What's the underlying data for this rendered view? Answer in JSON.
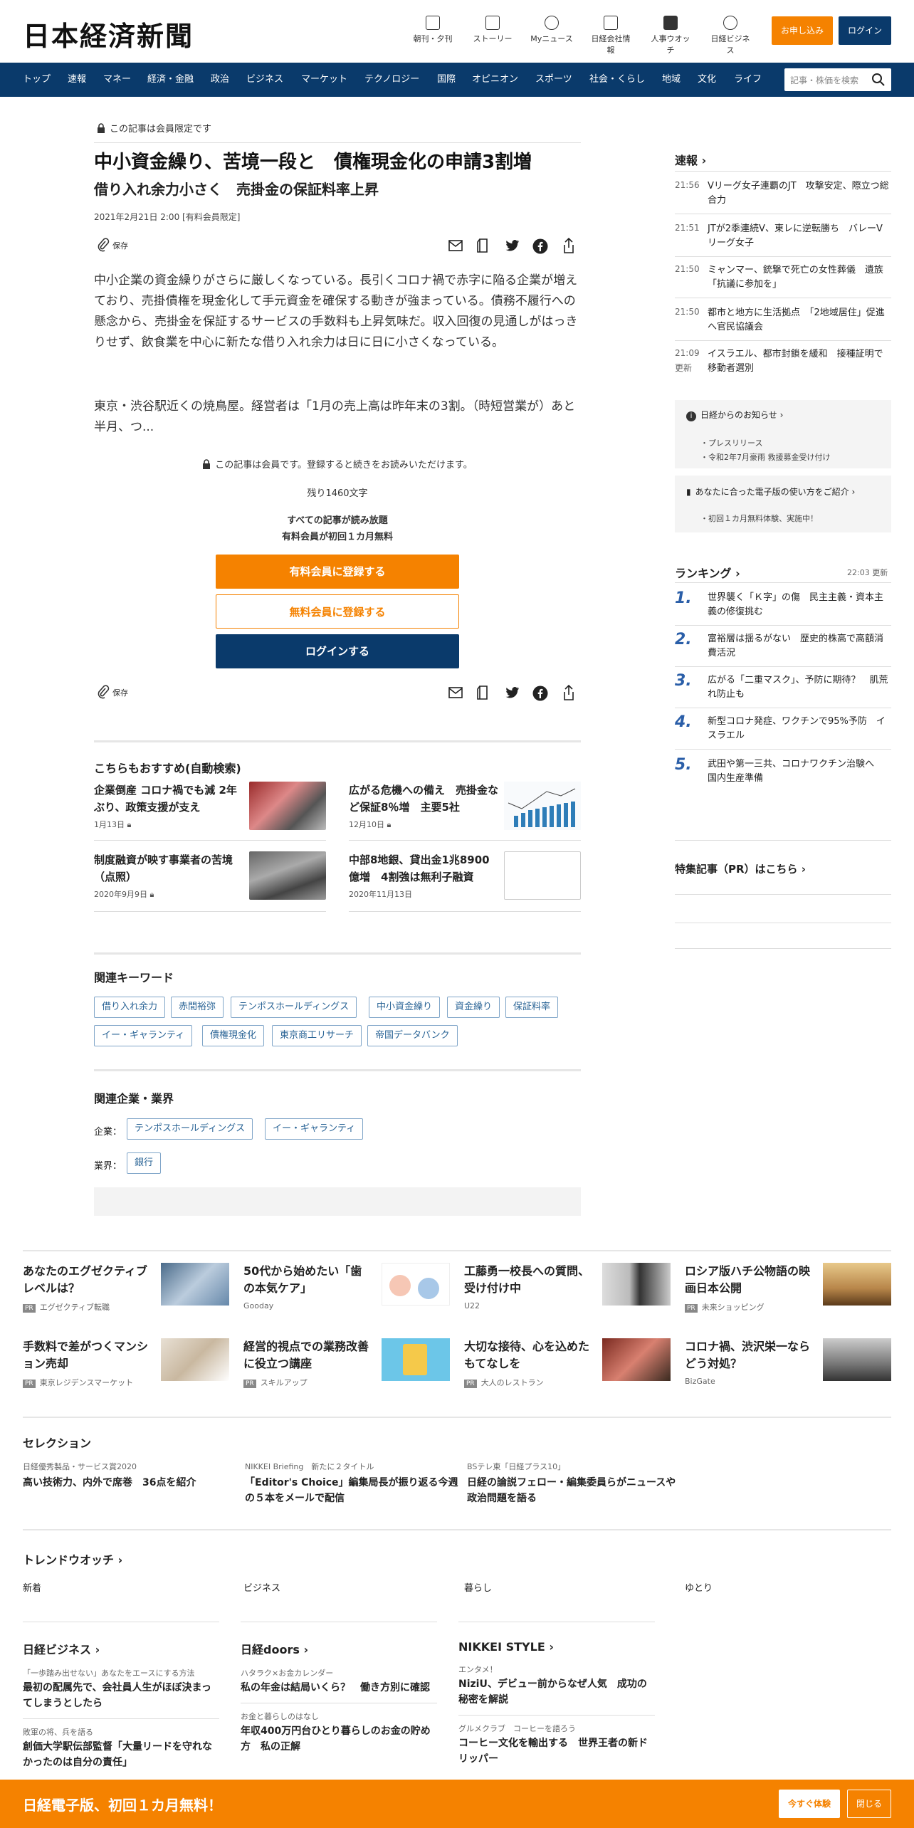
{
  "header": {
    "logo": "日本経済新聞",
    "icons": [
      {
        "label": "朝刊・夕刊"
      },
      {
        "label": "ストーリー"
      },
      {
        "label": "Myニュース"
      },
      {
        "label": "日経会社情報"
      },
      {
        "label": "人事ウオッチ"
      },
      {
        "label": "日経ビジネス"
      }
    ],
    "subscribe": "お申し込み",
    "login": "ログイン"
  },
  "nav": {
    "items": [
      "トップ",
      "速報",
      "マネー",
      "経済・金融",
      "政治",
      "ビジネス",
      "マーケット",
      "テクノロジー",
      "国際",
      "オピニオン",
      "スポーツ",
      "社会・くらし",
      "地域",
      "文化",
      "ライフ"
    ],
    "search_placeholder": "記事・株価を検索"
  },
  "article": {
    "members_only": "この記事は会員限定です",
    "title": "中小資金繰り、苦境一段と　債権現金化の申請3割増",
    "subtitle": "借り入れ余力小さく　売掛金の保証料率上昇",
    "date": "2021年2月21日 2:00 [有料会員限定]",
    "save": "保存",
    "p1": "中小企業の資金繰りがさらに厳しくなっている。長引くコロナ禍で赤字に陥る企業が増えており、売掛債権を現金化して手元資金を確保する動きが強まっている。債務不履行への懸念から、売掛金を保証するサービスの手数料も上昇気味だ。収入回復の見通しがはっきりせず、飲食業を中心に新たな借り入れ余力は日に日に小さくなっている。",
    "p2": "東京・渋谷駅近くの焼鳥屋。経営者は「1月の売上高は昨年末の3割。（時短営業が）あと半月、つ...",
    "members_note": "この記事は会員です。登録すると続きをお読みいただけます。",
    "remaining": "残り1460文字",
    "offer1": "すべての記事が読み放題",
    "offer2": "有料会員が初回１カ月無料",
    "btn_paid": "有料会員に登録する",
    "btn_free": "無料会員に登録する",
    "btn_login": "ログインする"
  },
  "recommend": {
    "title": "こちらもおすすめ(自動検索)",
    "items": [
      {
        "title": "企業倒産 コロナ禍でも減 2年ぶり、政策支援が支え",
        "date": "1月13日"
      },
      {
        "title": "広がる危機への備え　売掛金など保証8％増　主要5社",
        "date": "12月10日"
      },
      {
        "title": "制度融資が映す事業者の苦境（点照）",
        "date": "2020年9月9日"
      },
      {
        "title": "中部8地銀、貸出金1兆8900億増　4割強は無利子融資",
        "date": "2020年11月13日"
      }
    ]
  },
  "keywords": {
    "title": "関連キーワード",
    "items": [
      "借り入れ余力",
      "赤間裕弥",
      "テンポスホールディングス",
      "中小資金繰り",
      "資金繰り",
      "保証料率",
      "イー・ギャランティ",
      "債権現金化",
      "東京商工リサーチ",
      "帝国データバンク"
    ]
  },
  "companies": {
    "title": "関連企業・業界",
    "company_label": "企業：",
    "company_items": [
      "テンポスホールディングス",
      "イー・ギャランティ"
    ],
    "industry_label": "業界：",
    "industry_items": [
      "銀行"
    ]
  },
  "sidebar": {
    "breaking_title": "速報",
    "breaking": [
      {
        "time": "21:56",
        "text": "Vリーグ女子連覇のJT　攻撃安定、際立つ総合力"
      },
      {
        "time": "21:51",
        "text": "JTが2季連続V、東レに逆転勝ち　バレーVリーグ女子"
      },
      {
        "time": "21:50",
        "text": "ミャンマー、銃撃で死亡の女性葬儀　遺族「抗議に参加を」"
      },
      {
        "time": "21:50",
        "text": "都市と地方に生活拠点　「2地域居住」促進へ官民協議会"
      },
      {
        "time": "21:09",
        "time2": "更新",
        "text": "イスラエル、都市封鎖を緩和　接種証明で移動者選別"
      }
    ],
    "notice_title": "日経からのお知らせ",
    "notice_items": [
      "プレスリリース",
      "令和2年7月豪雨 救援募金受け付け"
    ],
    "notice2_title": "あなたに合った電子版の使い方をご紹介",
    "notice2_items": [
      "初回１カ月無料体験、実施中！"
    ],
    "ranking_title": "ランキング",
    "ranking_time": "22:03",
    "ranking_update": "更新",
    "ranking": [
      {
        "n": "1.",
        "text": "世界襲く「Ｋ字」の傷　民主主義・資本主義の修復挑む"
      },
      {
        "n": "2.",
        "text": "富裕層は揺るがない　歴史的株高で高額消費活況"
      },
      {
        "n": "3.",
        "text": "広がる「二重マスク」、予防に期待？　肌荒れ防止も"
      },
      {
        "n": "4.",
        "text": "新型コロナ発症、ワクチンで95%予防　イスラエル"
      },
      {
        "n": "5.",
        "text": "武田や第一三共、コロナワクチン治験へ　国内生産準備"
      }
    ],
    "pr_link": "特集記事（PR）はこちら"
  },
  "ads": [
    {
      "title": "あなたのエグゼクティブレベルは？",
      "src": "エグゼクティブ転職",
      "pr": true
    },
    {
      "title": "50代から始めたい「歯の本気ケア」",
      "src": "Gooday",
      "pr": false
    },
    {
      "title": "工藤勇一校長への質問、受け付け中",
      "src": "U22",
      "pr": false
    },
    {
      "title": "ロシア版ハチ公物語の映画日本公開",
      "src": "未来ショッピング",
      "pr": true
    },
    {
      "title": "手数料で差がつくマンション売却",
      "src": "東京レジデンスマーケット",
      "pr": true
    },
    {
      "title": "経営的視点での業務改善に役立つ講座",
      "src": "スキルアップ",
      "pr": true
    },
    {
      "title": "大切な接待、心を込めたもてなしを",
      "src": "大人のレストラン",
      "pr": true
    },
    {
      "title": "コロナ禍、渋沢栄一ならどう対処？",
      "src": "BizGate",
      "pr": false
    }
  ],
  "selection": {
    "title": "セレクション",
    "items": [
      {
        "kicker": "日経優秀製品・サービス賞2020",
        "title": "高い技術力、内外で席巻　36点を紹介"
      },
      {
        "kicker": "NIKKEI Briefing　新たに２タイトル",
        "title": "「Editor's Choice」編集局長が振り返る今週の５本をメールで配信"
      },
      {
        "kicker": "BSテレ東「日経プラス10」",
        "title": "日経の論説フェロー・編集委員らがニュースや政治問題を語る"
      }
    ]
  },
  "trend": {
    "title": "トレンドウオッチ",
    "tabs": [
      "新着",
      "ビジネス",
      "暮らし",
      "ゆとり"
    ]
  },
  "partners": [
    {
      "title": "日経ビジネス",
      "items": [
        {
          "kicker": "「一歩踏み出せない」あなたをエースにする方法",
          "text": "最初の配属先で、会社員人生がほぼ決まってしまうとしたら"
        },
        {
          "kicker": "敗軍の将、兵を語る",
          "text": "創価大学駅伝部監督「大量リードを守れなかったのは自分の責任」"
        }
      ]
    },
    {
      "title": "日経doors",
      "items": [
        {
          "kicker": "ハタラク×お金カレンダー",
          "text": "私の年金は結局いくら？　働き方別に確認"
        },
        {
          "kicker": "お金と暮らしのはなし",
          "text": "年収400万円台ひとり暮らしのお金の貯め方　私の正解"
        }
      ]
    },
    {
      "title": "NIKKEI STYLE",
      "items": [
        {
          "kicker": "エンタメ！",
          "text": "NiziU、デビュー前からなぜ人気　成功の秘密を解説"
        },
        {
          "kicker": "グルメクラブ　コーヒーを語ろう",
          "text": "コーヒー文化を輸出する　世界王者の新ドリッパー"
        }
      ]
    }
  ],
  "bottom": {
    "text": "日経電子版、初回１カ月無料！",
    "trial": "今すぐ体験",
    "close": "閉じる"
  }
}
